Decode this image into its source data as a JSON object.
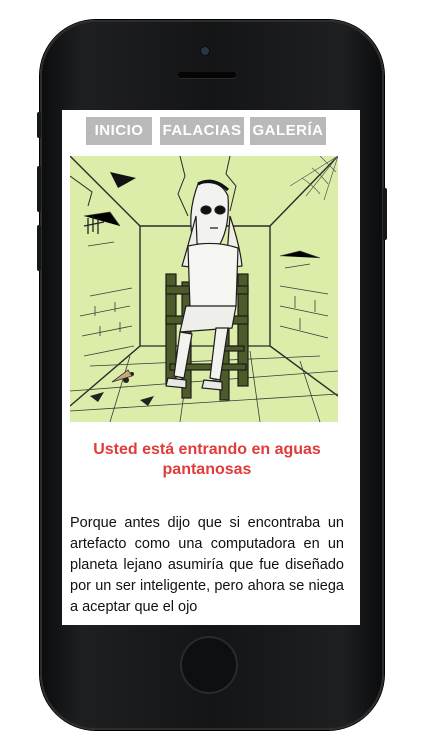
{
  "nav": {
    "tabs": [
      {
        "label": "INICIO"
      },
      {
        "label": "FALACIAS"
      },
      {
        "label": "GALERÍA"
      }
    ]
  },
  "hero_image": {
    "description_icon": "illustration-chair-figure-icon"
  },
  "content": {
    "headline": "Usted está entrando en aguas pantanosas",
    "body": "Porque antes dijo que si encontraba un artefacto como una computadora en un planeta lejano asumiría que fue diseñado por un ser inteligente, pero ahora se niega a aceptar que el ojo"
  },
  "colors": {
    "accent": "#e23b3b",
    "nav_tab": "#b9b9b9",
    "hero_background": "#dcedaa",
    "device": "#141516"
  }
}
